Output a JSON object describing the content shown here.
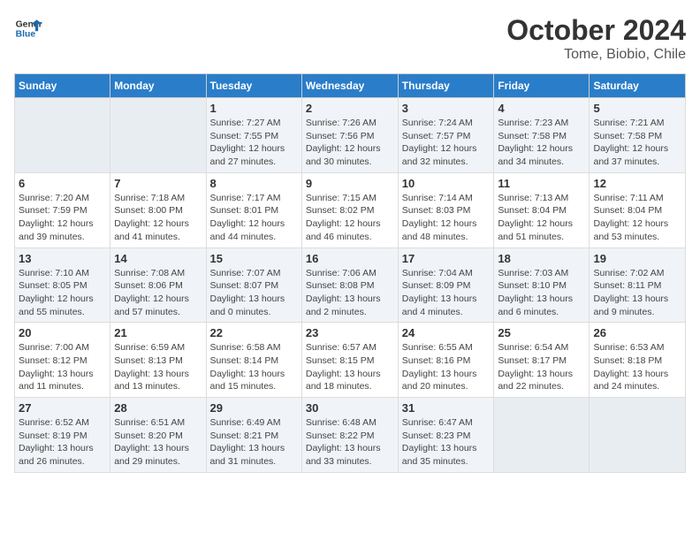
{
  "header": {
    "logo_line1": "General",
    "logo_line2": "Blue",
    "month_year": "October 2024",
    "location": "Tome, Biobio, Chile"
  },
  "weekdays": [
    "Sunday",
    "Monday",
    "Tuesday",
    "Wednesday",
    "Thursday",
    "Friday",
    "Saturday"
  ],
  "weeks": [
    [
      {
        "day": "",
        "info": ""
      },
      {
        "day": "",
        "info": ""
      },
      {
        "day": "1",
        "info": "Sunrise: 7:27 AM\nSunset: 7:55 PM\nDaylight: 12 hours\nand 27 minutes."
      },
      {
        "day": "2",
        "info": "Sunrise: 7:26 AM\nSunset: 7:56 PM\nDaylight: 12 hours\nand 30 minutes."
      },
      {
        "day": "3",
        "info": "Sunrise: 7:24 AM\nSunset: 7:57 PM\nDaylight: 12 hours\nand 32 minutes."
      },
      {
        "day": "4",
        "info": "Sunrise: 7:23 AM\nSunset: 7:58 PM\nDaylight: 12 hours\nand 34 minutes."
      },
      {
        "day": "5",
        "info": "Sunrise: 7:21 AM\nSunset: 7:58 PM\nDaylight: 12 hours\nand 37 minutes."
      }
    ],
    [
      {
        "day": "6",
        "info": "Sunrise: 7:20 AM\nSunset: 7:59 PM\nDaylight: 12 hours\nand 39 minutes."
      },
      {
        "day": "7",
        "info": "Sunrise: 7:18 AM\nSunset: 8:00 PM\nDaylight: 12 hours\nand 41 minutes."
      },
      {
        "day": "8",
        "info": "Sunrise: 7:17 AM\nSunset: 8:01 PM\nDaylight: 12 hours\nand 44 minutes."
      },
      {
        "day": "9",
        "info": "Sunrise: 7:15 AM\nSunset: 8:02 PM\nDaylight: 12 hours\nand 46 minutes."
      },
      {
        "day": "10",
        "info": "Sunrise: 7:14 AM\nSunset: 8:03 PM\nDaylight: 12 hours\nand 48 minutes."
      },
      {
        "day": "11",
        "info": "Sunrise: 7:13 AM\nSunset: 8:04 PM\nDaylight: 12 hours\nand 51 minutes."
      },
      {
        "day": "12",
        "info": "Sunrise: 7:11 AM\nSunset: 8:04 PM\nDaylight: 12 hours\nand 53 minutes."
      }
    ],
    [
      {
        "day": "13",
        "info": "Sunrise: 7:10 AM\nSunset: 8:05 PM\nDaylight: 12 hours\nand 55 minutes."
      },
      {
        "day": "14",
        "info": "Sunrise: 7:08 AM\nSunset: 8:06 PM\nDaylight: 12 hours\nand 57 minutes."
      },
      {
        "day": "15",
        "info": "Sunrise: 7:07 AM\nSunset: 8:07 PM\nDaylight: 13 hours\nand 0 minutes."
      },
      {
        "day": "16",
        "info": "Sunrise: 7:06 AM\nSunset: 8:08 PM\nDaylight: 13 hours\nand 2 minutes."
      },
      {
        "day": "17",
        "info": "Sunrise: 7:04 AM\nSunset: 8:09 PM\nDaylight: 13 hours\nand 4 minutes."
      },
      {
        "day": "18",
        "info": "Sunrise: 7:03 AM\nSunset: 8:10 PM\nDaylight: 13 hours\nand 6 minutes."
      },
      {
        "day": "19",
        "info": "Sunrise: 7:02 AM\nSunset: 8:11 PM\nDaylight: 13 hours\nand 9 minutes."
      }
    ],
    [
      {
        "day": "20",
        "info": "Sunrise: 7:00 AM\nSunset: 8:12 PM\nDaylight: 13 hours\nand 11 minutes."
      },
      {
        "day": "21",
        "info": "Sunrise: 6:59 AM\nSunset: 8:13 PM\nDaylight: 13 hours\nand 13 minutes."
      },
      {
        "day": "22",
        "info": "Sunrise: 6:58 AM\nSunset: 8:14 PM\nDaylight: 13 hours\nand 15 minutes."
      },
      {
        "day": "23",
        "info": "Sunrise: 6:57 AM\nSunset: 8:15 PM\nDaylight: 13 hours\nand 18 minutes."
      },
      {
        "day": "24",
        "info": "Sunrise: 6:55 AM\nSunset: 8:16 PM\nDaylight: 13 hours\nand 20 minutes."
      },
      {
        "day": "25",
        "info": "Sunrise: 6:54 AM\nSunset: 8:17 PM\nDaylight: 13 hours\nand 22 minutes."
      },
      {
        "day": "26",
        "info": "Sunrise: 6:53 AM\nSunset: 8:18 PM\nDaylight: 13 hours\nand 24 minutes."
      }
    ],
    [
      {
        "day": "27",
        "info": "Sunrise: 6:52 AM\nSunset: 8:19 PM\nDaylight: 13 hours\nand 26 minutes."
      },
      {
        "day": "28",
        "info": "Sunrise: 6:51 AM\nSunset: 8:20 PM\nDaylight: 13 hours\nand 29 minutes."
      },
      {
        "day": "29",
        "info": "Sunrise: 6:49 AM\nSunset: 8:21 PM\nDaylight: 13 hours\nand 31 minutes."
      },
      {
        "day": "30",
        "info": "Sunrise: 6:48 AM\nSunset: 8:22 PM\nDaylight: 13 hours\nand 33 minutes."
      },
      {
        "day": "31",
        "info": "Sunrise: 6:47 AM\nSunset: 8:23 PM\nDaylight: 13 hours\nand 35 minutes."
      },
      {
        "day": "",
        "info": ""
      },
      {
        "day": "",
        "info": ""
      }
    ]
  ]
}
